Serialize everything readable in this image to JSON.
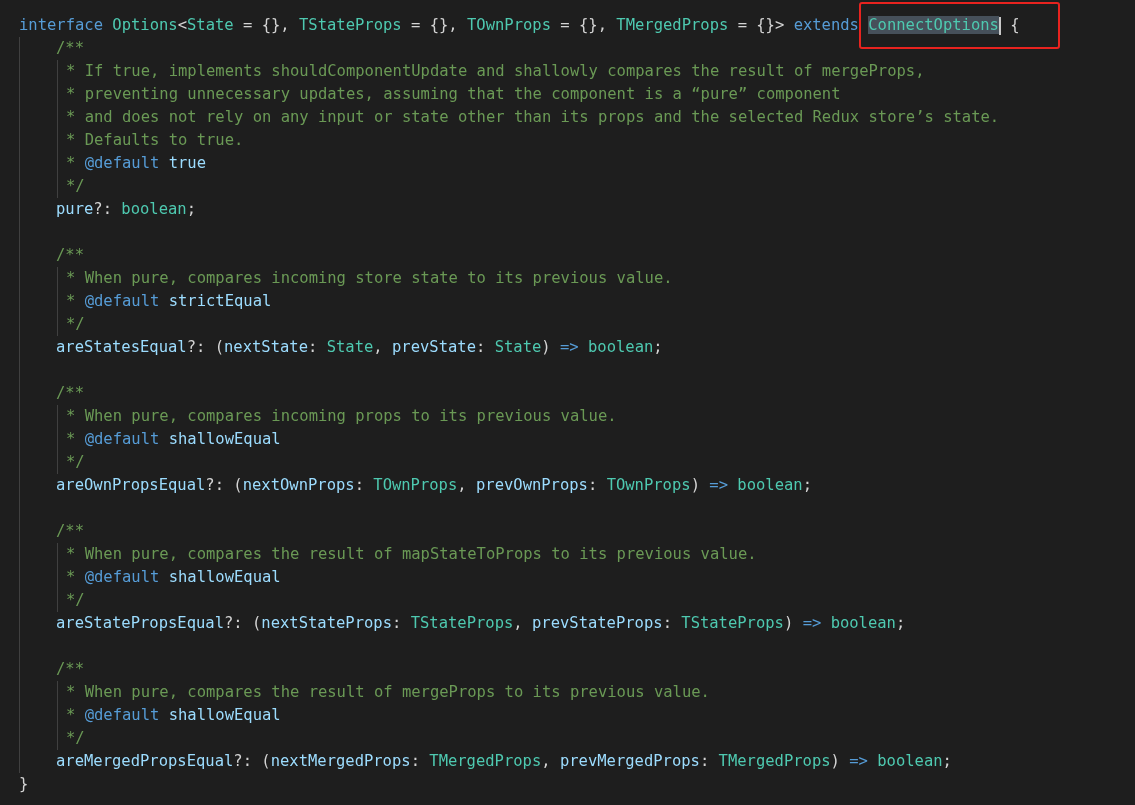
{
  "header": [
    {
      "kind": "keyword",
      "text": "interface "
    },
    {
      "kind": "type",
      "text": "Options"
    },
    {
      "kind": "plain",
      "text": "<"
    },
    {
      "kind": "type",
      "text": "State"
    },
    {
      "kind": "plain",
      "text": " = {}, "
    },
    {
      "kind": "type",
      "text": "TStateProps"
    },
    {
      "kind": "plain",
      "text": " = {}, "
    },
    {
      "kind": "type",
      "text": "TOwnProps"
    },
    {
      "kind": "plain",
      "text": " = {}, "
    },
    {
      "kind": "type",
      "text": "TMergedProps"
    },
    {
      "kind": "plain",
      "text": " = {}> "
    },
    {
      "kind": "keyword",
      "text": "extends "
    },
    {
      "kind": "type",
      "text": "ConnectOptions",
      "selected": true,
      "cursor": true,
      "boxed": true
    },
    {
      "kind": "plain",
      "text": " {"
    }
  ],
  "members": [
    {
      "doc_open": "/**",
      "doc": [
        [
          {
            "kind": "comment",
            "text": "* If true, implements shouldComponentUpdate and shallowly compares the result of mergeProps,"
          }
        ],
        [
          {
            "kind": "comment",
            "text": "* preventing unnecessary updates, assuming that the component is a “pure” component"
          }
        ],
        [
          {
            "kind": "comment",
            "text": "* and does not rely on any input or state other than its props and the selected Redux store’s state."
          }
        ],
        [
          {
            "kind": "comment",
            "text": "* Defaults to true."
          }
        ],
        [
          {
            "kind": "comment",
            "text": "* "
          },
          {
            "kind": "tag",
            "text": "@default"
          },
          {
            "kind": "value",
            "text": " true"
          }
        ],
        [
          {
            "kind": "comment",
            "text": "*/"
          }
        ]
      ],
      "declaration": [
        {
          "kind": "property",
          "text": "pure"
        },
        {
          "kind": "plain",
          "text": "?: "
        },
        {
          "kind": "type",
          "text": "boolean"
        },
        {
          "kind": "plain",
          "text": ";"
        }
      ]
    },
    {
      "doc_open": "/**",
      "doc": [
        [
          {
            "kind": "comment",
            "text": "* When pure, compares incoming store state to its previous value."
          }
        ],
        [
          {
            "kind": "comment",
            "text": "* "
          },
          {
            "kind": "tag",
            "text": "@default"
          },
          {
            "kind": "value",
            "text": " strictEqual"
          }
        ],
        [
          {
            "kind": "comment",
            "text": "*/"
          }
        ]
      ],
      "declaration": [
        {
          "kind": "property",
          "text": "areStatesEqual"
        },
        {
          "kind": "plain",
          "text": "?: ("
        },
        {
          "kind": "property",
          "text": "nextState"
        },
        {
          "kind": "plain",
          "text": ": "
        },
        {
          "kind": "type",
          "text": "State"
        },
        {
          "kind": "plain",
          "text": ", "
        },
        {
          "kind": "property",
          "text": "prevState"
        },
        {
          "kind": "plain",
          "text": ": "
        },
        {
          "kind": "type",
          "text": "State"
        },
        {
          "kind": "plain",
          "text": ") "
        },
        {
          "kind": "keyword",
          "text": "=>"
        },
        {
          "kind": "type",
          "text": " boolean"
        },
        {
          "kind": "plain",
          "text": ";"
        }
      ]
    },
    {
      "doc_open": "/**",
      "doc": [
        [
          {
            "kind": "comment",
            "text": "* When pure, compares incoming props to its previous value."
          }
        ],
        [
          {
            "kind": "comment",
            "text": "* "
          },
          {
            "kind": "tag",
            "text": "@default"
          },
          {
            "kind": "value",
            "text": " shallowEqual"
          }
        ],
        [
          {
            "kind": "comment",
            "text": "*/"
          }
        ]
      ],
      "declaration": [
        {
          "kind": "property",
          "text": "areOwnPropsEqual"
        },
        {
          "kind": "plain",
          "text": "?: ("
        },
        {
          "kind": "property",
          "text": "nextOwnProps"
        },
        {
          "kind": "plain",
          "text": ": "
        },
        {
          "kind": "type",
          "text": "TOwnProps"
        },
        {
          "kind": "plain",
          "text": ", "
        },
        {
          "kind": "property",
          "text": "prevOwnProps"
        },
        {
          "kind": "plain",
          "text": ": "
        },
        {
          "kind": "type",
          "text": "TOwnProps"
        },
        {
          "kind": "plain",
          "text": ") "
        },
        {
          "kind": "keyword",
          "text": "=>"
        },
        {
          "kind": "type",
          "text": " boolean"
        },
        {
          "kind": "plain",
          "text": ";"
        }
      ]
    },
    {
      "doc_open": "/**",
      "doc": [
        [
          {
            "kind": "comment",
            "text": "* When pure, compares the result of mapStateToProps to its previous value."
          }
        ],
        [
          {
            "kind": "comment",
            "text": "* "
          },
          {
            "kind": "tag",
            "text": "@default"
          },
          {
            "kind": "value",
            "text": " shallowEqual"
          }
        ],
        [
          {
            "kind": "comment",
            "text": "*/"
          }
        ]
      ],
      "declaration": [
        {
          "kind": "property",
          "text": "areStatePropsEqual"
        },
        {
          "kind": "plain",
          "text": "?: ("
        },
        {
          "kind": "property",
          "text": "nextStateProps"
        },
        {
          "kind": "plain",
          "text": ": "
        },
        {
          "kind": "type",
          "text": "TStateProps"
        },
        {
          "kind": "plain",
          "text": ", "
        },
        {
          "kind": "property",
          "text": "prevStateProps"
        },
        {
          "kind": "plain",
          "text": ": "
        },
        {
          "kind": "type",
          "text": "TStateProps"
        },
        {
          "kind": "plain",
          "text": ") "
        },
        {
          "kind": "keyword",
          "text": "=>"
        },
        {
          "kind": "type",
          "text": " boolean"
        },
        {
          "kind": "plain",
          "text": ";"
        }
      ]
    },
    {
      "doc_open": "/**",
      "doc": [
        [
          {
            "kind": "comment",
            "text": "* When pure, compares the result of mergeProps to its previous value."
          }
        ],
        [
          {
            "kind": "comment",
            "text": "* "
          },
          {
            "kind": "tag",
            "text": "@default"
          },
          {
            "kind": "value",
            "text": " shallowEqual"
          }
        ],
        [
          {
            "kind": "comment",
            "text": "*/"
          }
        ]
      ],
      "declaration": [
        {
          "kind": "property",
          "text": "areMergedPropsEqual"
        },
        {
          "kind": "plain",
          "text": "?: ("
        },
        {
          "kind": "property",
          "text": "nextMergedProps"
        },
        {
          "kind": "plain",
          "text": ": "
        },
        {
          "kind": "type",
          "text": "TMergedProps"
        },
        {
          "kind": "plain",
          "text": ", "
        },
        {
          "kind": "property",
          "text": "prevMergedProps"
        },
        {
          "kind": "plain",
          "text": ": "
        },
        {
          "kind": "type",
          "text": "TMergedProps"
        },
        {
          "kind": "plain",
          "text": ") "
        },
        {
          "kind": "keyword",
          "text": "=>"
        },
        {
          "kind": "type",
          "text": " boolean"
        },
        {
          "kind": "plain",
          "text": ";"
        }
      ]
    }
  ],
  "footer": "}"
}
